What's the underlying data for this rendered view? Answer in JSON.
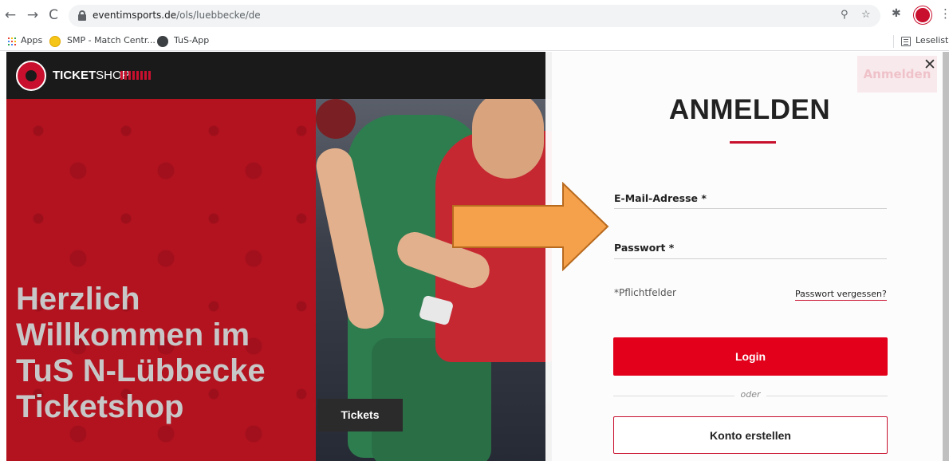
{
  "browser": {
    "url_domain": "eventimsports.de",
    "url_path": "/ols/luebbecke/de",
    "nav": {
      "back": "←",
      "forward": "→",
      "reload": "C"
    },
    "bookmarks": [
      {
        "label": "Apps"
      },
      {
        "label": "SMP - Match Centr..."
      },
      {
        "label": "TuS-App"
      }
    ],
    "reading_list": "Leseliste"
  },
  "header": {
    "brand_bold": "TICKET",
    "brand_light": "SHOP"
  },
  "hero": {
    "title_lines": [
      "Herzlich",
      "Willkommen im",
      "TuS N-Lübbecke",
      "Ticketshop"
    ],
    "tickets_label": "Tickets"
  },
  "login": {
    "background_button": "Anmelden",
    "heading": "ANMELDEN",
    "email_label": "E-Mail-Adresse *",
    "password_label": "Passwort *",
    "required_hint": "*Pflichtfelder",
    "forgot_label": "Passwort vergessen?",
    "login_label": "Login",
    "divider": "oder",
    "signup_label": "Konto erstellen",
    "close_symbol": "✕"
  },
  "colors": {
    "brand_red": "#e2001a",
    "hero_red": "#b3121f",
    "arrow_orange": "#f5a04a"
  }
}
